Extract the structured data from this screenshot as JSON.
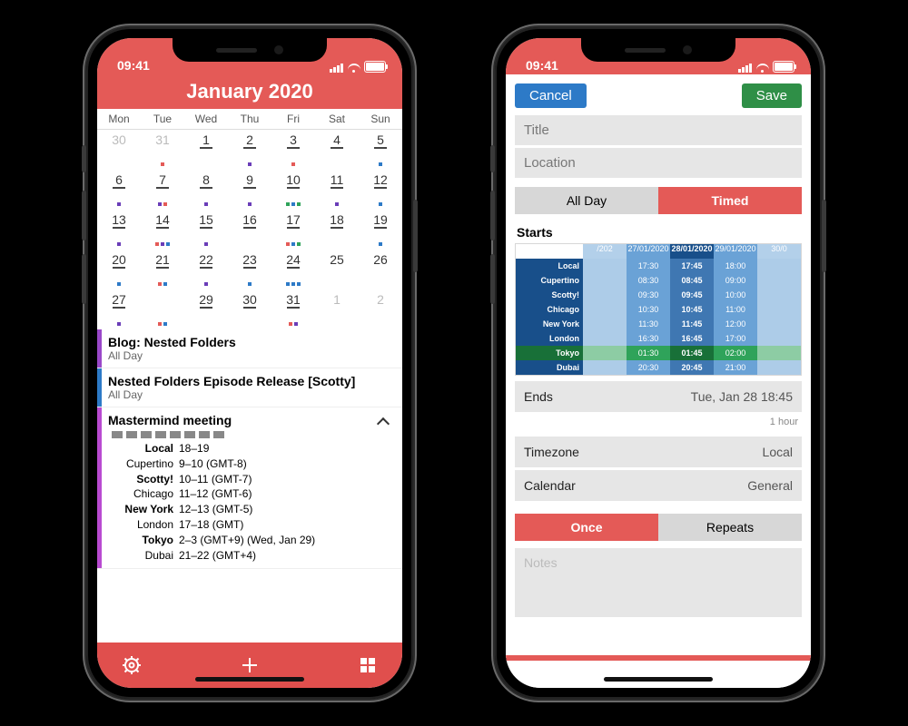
{
  "status": {
    "time": "09:41"
  },
  "left": {
    "month_title": "January 2020",
    "dow": [
      "Mon",
      "Tue",
      "Wed",
      "Thu",
      "Fri",
      "Sat",
      "Sun"
    ],
    "cells": [
      {
        "n": "30",
        "cls": "prev",
        "und": false,
        "dots": []
      },
      {
        "n": "31",
        "cls": "prev",
        "und": false,
        "dots": [
          "#e45a57"
        ]
      },
      {
        "n": "1",
        "und": true,
        "dots": []
      },
      {
        "n": "2",
        "und": true,
        "dots": [
          "#6a3db8"
        ]
      },
      {
        "n": "3",
        "und": true,
        "dots": [
          "#e45a57"
        ]
      },
      {
        "n": "4",
        "und": true,
        "dots": []
      },
      {
        "n": "5",
        "und": true,
        "dots": [
          "#2d7ac7"
        ]
      },
      {
        "n": "6",
        "und": true,
        "dots": [
          "#6a3db8"
        ]
      },
      {
        "n": "7",
        "und": true,
        "dots": [
          "#6a3db8",
          "#e45a57"
        ]
      },
      {
        "n": "8",
        "und": true,
        "dots": [
          "#6a3db8"
        ]
      },
      {
        "n": "9",
        "und": true,
        "dots": [
          "#6a3db8"
        ]
      },
      {
        "n": "10",
        "und": true,
        "dots": [
          "#2fa35a",
          "#2d7ac7",
          "#2fa35a"
        ]
      },
      {
        "n": "11",
        "und": true,
        "dots": [
          "#6a3db8"
        ]
      },
      {
        "n": "12",
        "und": true,
        "dots": [
          "#2d7ac7"
        ]
      },
      {
        "n": "13",
        "und": true,
        "dots": [
          "#6a3db8"
        ]
      },
      {
        "n": "14",
        "und": true,
        "dots": [
          "#e45a57",
          "#6a3db8",
          "#2d7ac7"
        ]
      },
      {
        "n": "15",
        "und": true,
        "dots": [
          "#6a3db8"
        ]
      },
      {
        "n": "16",
        "und": true,
        "dots": []
      },
      {
        "n": "17",
        "und": true,
        "dots": [
          "#e45a57",
          "#2d7ac7",
          "#2fa35a"
        ]
      },
      {
        "n": "18",
        "und": true,
        "dots": []
      },
      {
        "n": "19",
        "und": true,
        "dots": [
          "#2d7ac7"
        ]
      },
      {
        "n": "20",
        "und": true,
        "dots": [
          "#2d7ac7"
        ]
      },
      {
        "n": "21",
        "und": true,
        "dots": [
          "#e45a57",
          "#2d7ac7"
        ]
      },
      {
        "n": "22",
        "und": true,
        "dots": [
          "#6a3db8"
        ]
      },
      {
        "n": "23",
        "und": true,
        "dots": [
          "#2d7ac7"
        ]
      },
      {
        "n": "24",
        "und": true,
        "dots": [
          "#2d7ac7",
          "#2d7ac7",
          "#2d7ac7"
        ]
      },
      {
        "n": "25",
        "und": false,
        "dots": []
      },
      {
        "n": "26",
        "und": false,
        "dots": []
      },
      {
        "n": "27",
        "und": true,
        "dots": [
          "#6a3db8"
        ]
      },
      {
        "n": "28",
        "und": false,
        "dots": [
          "#e45a57",
          "#2d7ac7"
        ],
        "selected": true
      },
      {
        "n": "29",
        "und": true,
        "dots": []
      },
      {
        "n": "30",
        "und": true,
        "dots": []
      },
      {
        "n": "31",
        "und": true,
        "dots": [
          "#e45a57",
          "#6a3db8"
        ]
      },
      {
        "n": "1",
        "cls": "next",
        "und": false,
        "dots": []
      },
      {
        "n": "2",
        "cls": "next",
        "und": false,
        "dots": []
      }
    ],
    "events": [
      {
        "stripe": "#9a48c9",
        "title": "Blog: Nested Folders",
        "sub": "All Day"
      },
      {
        "stripe": "#2d7ac7",
        "title": "Nested Folders Episode Release [Scotty]",
        "sub": "All Day"
      },
      {
        "stripe": "#b94bd1",
        "title": "Mastermind meeting",
        "chev": true,
        "tz_count": 8,
        "tz": [
          {
            "lab": "Local",
            "val": "18–19",
            "bold": true
          },
          {
            "lab": "Cupertino",
            "val": "9–10 (GMT-8)"
          },
          {
            "lab": "Scotty!",
            "val": "10–11 (GMT-7)",
            "bold": true
          },
          {
            "lab": "Chicago",
            "val": "11–12 (GMT-6)"
          },
          {
            "lab": "New York",
            "val": "12–13 (GMT-5)",
            "bold": true
          },
          {
            "lab": "London",
            "val": "17–18 (GMT)"
          },
          {
            "lab": "Tokyo",
            "val": "2–3 (GMT+9) (Wed, Jan 29)",
            "bold": true
          },
          {
            "lab": "Dubai",
            "val": "21–22 (GMT+4)"
          }
        ]
      }
    ]
  },
  "right": {
    "cancel": "Cancel",
    "save": "Save",
    "title_ph": "Title",
    "location_ph": "Location",
    "seg_allday": "All Day",
    "seg_timed": "Timed",
    "starts_label": "Starts",
    "ends_label": "Ends",
    "ends_value": "Tue, Jan 28 18:45",
    "duration": "1 hour",
    "timezone_label": "Timezone",
    "timezone_value": "Local",
    "calendar_label": "Calendar",
    "calendar_value": "General",
    "seg_once": "Once",
    "seg_repeats": "Repeats",
    "notes_ph": "Notes",
    "picker": {
      "dates": [
        "",
        "/202",
        "27/01/2020",
        "28/01/2020",
        "29/01/2020",
        "30/0"
      ],
      "selected_col": 3,
      "rows": [
        {
          "label": "Local",
          "green": false,
          "vals": [
            "",
            "17:30",
            "17:45",
            "18:00",
            ""
          ]
        },
        {
          "label": "Cupertino",
          "green": false,
          "vals": [
            "",
            "08:30",
            "08:45",
            "09:00",
            ""
          ]
        },
        {
          "label": "Scotty!",
          "green": false,
          "vals": [
            "",
            "09:30",
            "09:45",
            "10:00",
            ""
          ]
        },
        {
          "label": "Chicago",
          "green": false,
          "vals": [
            "",
            "10:30",
            "10:45",
            "11:00",
            ""
          ]
        },
        {
          "label": "New York",
          "green": false,
          "vals": [
            "",
            "11:30",
            "11:45",
            "12:00",
            ""
          ]
        },
        {
          "label": "London",
          "green": false,
          "vals": [
            "",
            "16:30",
            "16:45",
            "17:00",
            ""
          ]
        },
        {
          "label": "Tokyo",
          "green": true,
          "vals": [
            "",
            "01:30",
            "01:45",
            "02:00",
            ""
          ]
        },
        {
          "label": "Dubai",
          "green": false,
          "vals": [
            "",
            "20:30",
            "20:45",
            "21:00",
            ""
          ]
        }
      ]
    }
  }
}
